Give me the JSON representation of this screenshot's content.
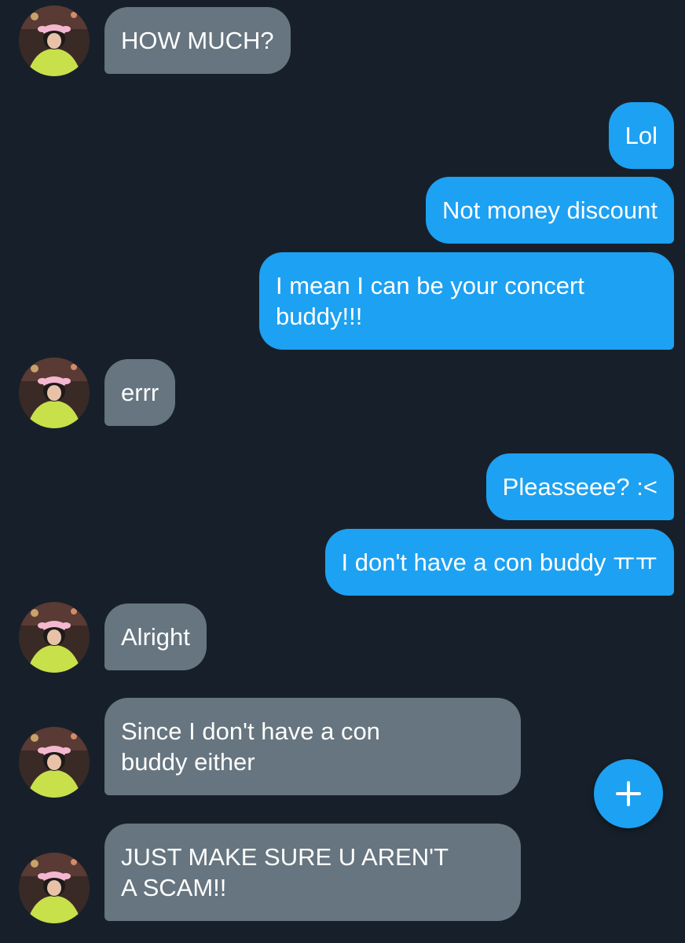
{
  "conversation": {
    "messages": [
      {
        "direction": "in",
        "text": "HOW MUCH?"
      },
      {
        "direction": "out",
        "text": "Lol"
      },
      {
        "direction": "out",
        "text": "Not money discount"
      },
      {
        "direction": "out",
        "text": "I mean I can be your concert\nbuddy!!!"
      },
      {
        "direction": "in",
        "text": "errr"
      },
      {
        "direction": "out",
        "text": "Pleasseee? :<"
      },
      {
        "direction": "out",
        "text": "I don't have a con buddy ㅠㅠ"
      },
      {
        "direction": "in",
        "text": "Alright"
      },
      {
        "direction": "in",
        "text": "Since I don't have a con\nbuddy either"
      },
      {
        "direction": "in",
        "text": "JUST MAKE SURE U AREN'T\nA SCAM!!"
      }
    ]
  },
  "compose_button": {
    "icon": "plus-icon"
  },
  "colors": {
    "background": "#17202a",
    "incoming_bubble": "#66757f",
    "outgoing_bubble": "#1da1f2",
    "accent": "#1da1f2"
  }
}
